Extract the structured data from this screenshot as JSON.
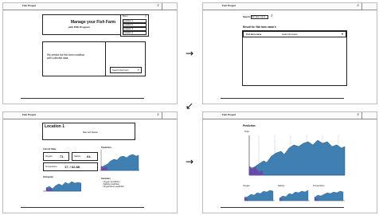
{
  "panels": [
    {
      "app_title": "Fish Project",
      "hero_title": "Manage your Fish Farm",
      "hero_subtitle": "with FRIL Program",
      "menu_header": "Menu",
      "menu_header_btn": "[ ]",
      "menu_items": [
        "Location 1",
        "Location 2",
        "Location 3",
        "Location 4"
      ],
      "predict_text_1": "We predict the fish farm condition",
      "predict_text_2": "with collected data.",
      "cta_label": "Search Fish Farm",
      "cta_icon": "search-icon"
    },
    {
      "app_title": "Fish Project",
      "search_label": "Search:",
      "search_value": "fish farm name",
      "results_title": "Result for 'fish farm name's",
      "result_row_name": "Fish farm name",
      "result_row_detail": "detail information"
    },
    {
      "app_title": "Fish Project",
      "location_title": "Location 1",
      "location_subtitle": "Map with Marker",
      "current_state_title": "Current State",
      "metrics": [
        {
          "label": "Oxygen",
          "value": "71."
        },
        {
          "label": "Salinity",
          "value": "64."
        },
        {
          "label": "Temperature",
          "value": "17. / 62.88."
        }
      ],
      "histogram_title": "Histogram",
      "prediction_title": "Prediction",
      "summary_title": "Summary",
      "summary_lines": [
        "- Oxygen prediction",
        "- Salinity prediction",
        "- Temperature prediction"
      ]
    },
    {
      "app_title": "Fish Project",
      "page_title": "Prediction",
      "main_chart_label": "Total",
      "small_chart_titles": [
        "Oxygen",
        "Salinity",
        "Temperature"
      ]
    }
  ],
  "arrows": [
    "→",
    "↙",
    "→"
  ],
  "colors": {
    "chart_fill": "#3f7fb2",
    "chart_accent": "#6a4aa8",
    "border": "#222222"
  }
}
